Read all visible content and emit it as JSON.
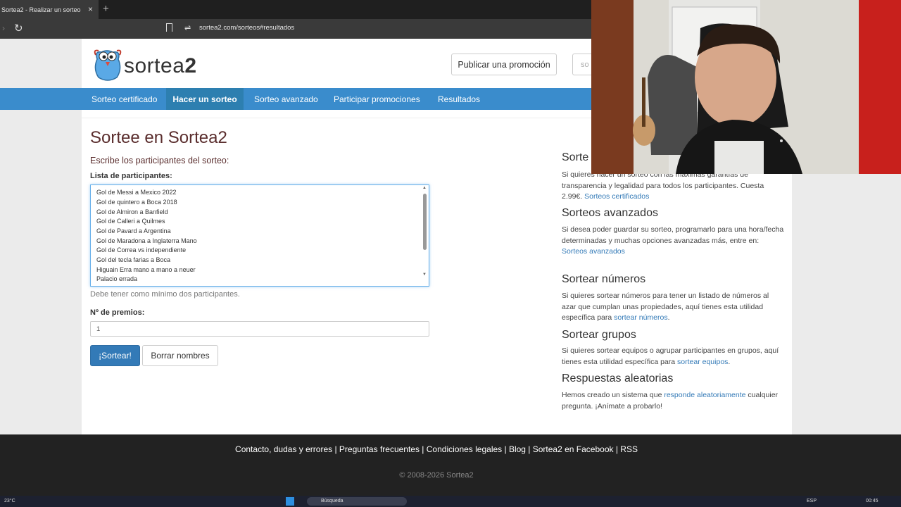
{
  "browser": {
    "tab_title": "Sortea2 - Realizar un sorteo",
    "close_glyph": "×",
    "new_tab_glyph": "+",
    "back_glyph": "›",
    "reload_glyph": "↻",
    "siteinfo_glyph": "⇌",
    "url": "sortea2.com/sorteos#resultados"
  },
  "header": {
    "logo_text": "sortea",
    "logo_number": "2",
    "publish_button": "Publicar una promoción",
    "search_stub": "so"
  },
  "nav": {
    "items": [
      "Sorteo certificado",
      "Hacer un sorteo",
      "Sorteo avanzado",
      "Participar promociones",
      "Resultados"
    ],
    "active": "Hacer un sorteo"
  },
  "main": {
    "title": "Sortee en Sortea2",
    "subtitle": "Escribe los participantes del sorteo:",
    "participants_label": "Lista de participantes:",
    "participants": [
      "Gol de Messi a Mexico 2022",
      "Gol de quintero a Boca 2018",
      "Gol de Almiron a Banfield",
      "Gol de Calleri a Quilmes",
      "Gol de Pavard a Argentina",
      "Gol de Maradona a Inglaterra Mano",
      "Gol de Correa vs independiente",
      "Gol del tecla farias a Boca",
      "Higuain Erra mano a mano a neuer",
      "Palacio errada"
    ],
    "helper_text": "Debe tener como mínimo dos participantes.",
    "prizes_label": "Nº de premios:",
    "prizes_value": "1",
    "draw_button": "¡Sortear!",
    "clear_button": "Borrar nombres"
  },
  "sidebar": {
    "certified_title": "Sorte",
    "certified_text": "Si quieres hacer un sorteo con las máximas garantías de transparencia y legalidad para todos los participantes. Cuesta 2.99€.",
    "certified_link": "Sorteos certificados",
    "advanced_title": "Sorteos avanzados",
    "advanced_text": "Si desea poder guardar su sorteo, programarlo para una hora/fecha determinadas y muchas opciones avanzadas más, entre en:",
    "advanced_link": "Sorteos avanzados",
    "numbers_title": "Sortear números",
    "numbers_text": "Si quieres sortear números para tener un listado de números al azar que cumplan unas propiedades, aquí tienes esta utilidad específica para",
    "numbers_link": "sortear números",
    "groups_title": "Sortear grupos",
    "groups_text": "Si quieres sortear equipos o agrupar participantes en grupos, aquí tienes esta utilidad específica para",
    "groups_link": "sortear equipos",
    "random_title": "Respuestas aleatorias",
    "random_text_1": "Hemos creado un sistema que",
    "random_link": "responde aleatoriamente",
    "random_text_2": "cualquier pregunta. ¡Anímate a probarlo!"
  },
  "footer": {
    "links": "Contacto, dudas y errores |  Preguntas frecuentes |  Condiciones legales |  Blog |  Sortea2 en Facebook |  RSS",
    "copyright": "© 2008-2026 Sortea2"
  },
  "taskbar": {
    "weather": "23°C",
    "search": "Búsqueda",
    "lang": "ESP",
    "time": "00:45"
  },
  "colors": {
    "nav_blue": "#3a8ccc",
    "title_brown": "#5a2d2d",
    "link_blue": "#337ab7"
  }
}
